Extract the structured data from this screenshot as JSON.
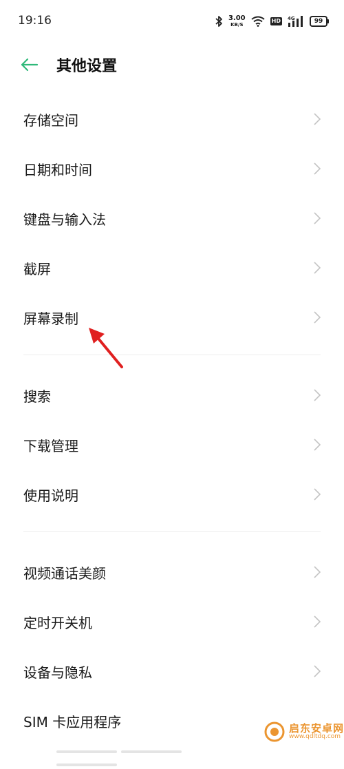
{
  "status_bar": {
    "time": "19:16",
    "net_speed_value": "3.00",
    "net_speed_unit": "KB/S",
    "hd_badge": "HD",
    "signal_label": "4G",
    "battery": "99"
  },
  "header": {
    "title": "其他设置"
  },
  "groups": [
    {
      "items": [
        {
          "label": "存储空间"
        },
        {
          "label": "日期和时间"
        },
        {
          "label": "键盘与输入法"
        },
        {
          "label": "截屏"
        },
        {
          "label": "屏幕录制"
        }
      ]
    },
    {
      "items": [
        {
          "label": "搜索"
        },
        {
          "label": "下载管理"
        },
        {
          "label": "使用说明"
        }
      ]
    },
    {
      "items": [
        {
          "label": "视频通话美颜"
        },
        {
          "label": "定时开关机"
        },
        {
          "label": "设备与隐私"
        },
        {
          "label": "SIM 卡应用程序"
        }
      ]
    }
  ],
  "watermark": {
    "main": "启东安卓网",
    "url": "www.qdltdq.com"
  },
  "colors": {
    "accent": "#2fb97a",
    "annotation_arrow": "#e02020",
    "chevron": "#c4c4c4"
  }
}
